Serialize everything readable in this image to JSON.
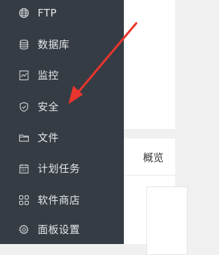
{
  "sidebar": {
    "items": [
      {
        "label": "FTP",
        "icon": "globe-icon"
      },
      {
        "label": "数据库",
        "icon": "database-icon"
      },
      {
        "label": "监控",
        "icon": "monitor-icon"
      },
      {
        "label": "安全",
        "icon": "shield-icon"
      },
      {
        "label": "文件",
        "icon": "folder-icon"
      },
      {
        "label": "计划任务",
        "icon": "calendar-icon"
      },
      {
        "label": "软件商店",
        "icon": "grid-icon"
      },
      {
        "label": "面板设置",
        "icon": "gear-icon"
      }
    ]
  },
  "main": {
    "tabs": [
      {
        "label": "概览"
      }
    ]
  },
  "annotation": {
    "icon": "arrow-icon",
    "color": "#e8352e"
  },
  "colors": {
    "sidebar_bg": "#363c44",
    "sidebar_text": "#e6e8ea",
    "accent": "#e8352e"
  }
}
